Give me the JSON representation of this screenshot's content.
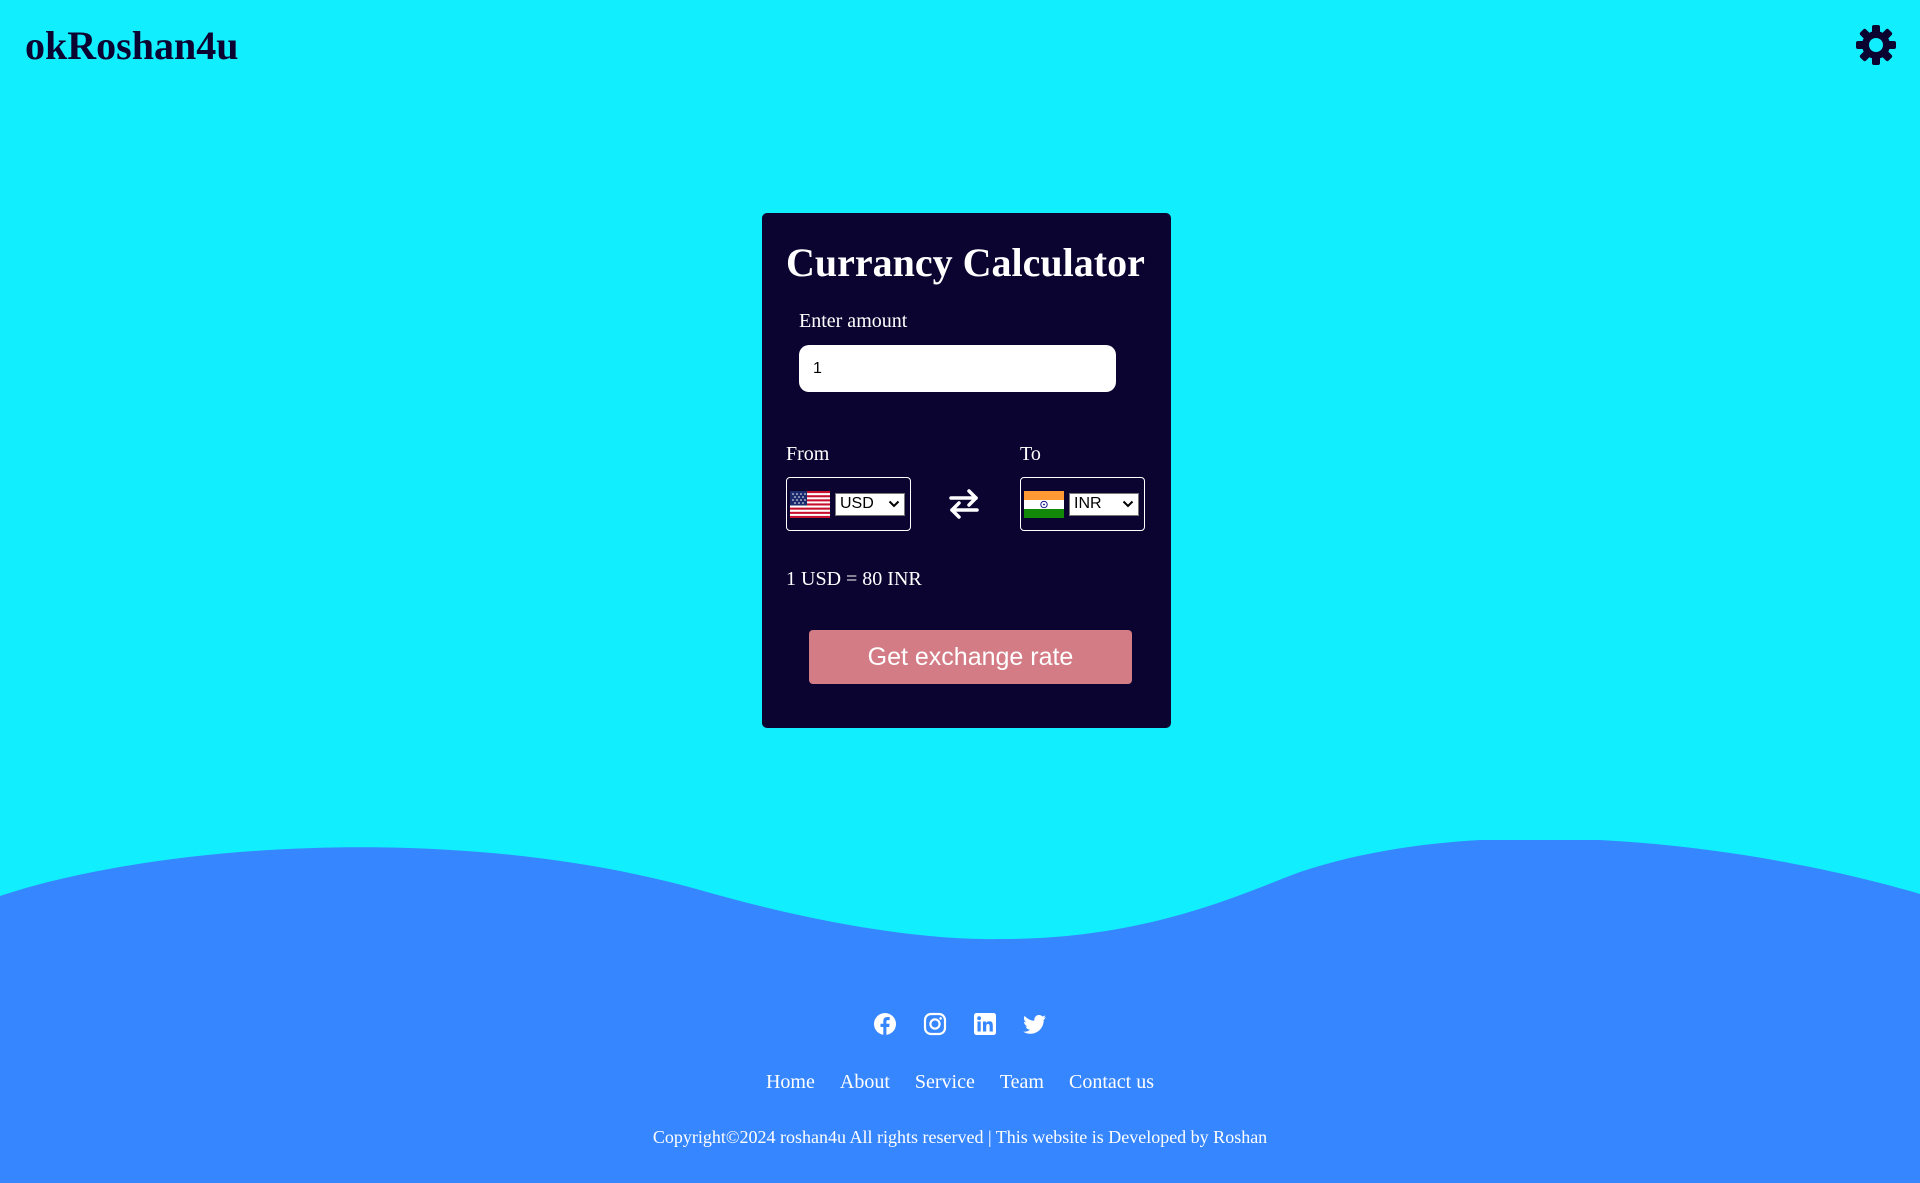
{
  "header": {
    "logo": "okRoshan4u",
    "theme_icon": "gear-icon"
  },
  "calculator": {
    "title": "Currancy Calculator",
    "amount_label": "Enter amount",
    "amount_value": "1",
    "from_label": "From",
    "to_label": "To",
    "from_currency": "USD",
    "from_flag": "us-flag-icon",
    "to_currency": "INR",
    "to_flag": "india-flag-icon",
    "swap_icon": "swap-arrows-icon",
    "rate_text": "1 USD = 80 INR",
    "button_label": "Get exchange rate"
  },
  "footer": {
    "socials": [
      "facebook-icon",
      "instagram-icon",
      "linkedin-icon",
      "twitter-icon"
    ],
    "nav": [
      "Home",
      "About",
      "Service",
      "Team",
      "Contact us"
    ],
    "copyright": "Copyright©2024 roshan4u All rights reserved | This website is Developed by Roshan"
  },
  "colors": {
    "background": "#11efff",
    "card": "#0b0430",
    "wave": "#3686ff",
    "button": "#d47c86",
    "text_on_dark": "#ffffff"
  }
}
